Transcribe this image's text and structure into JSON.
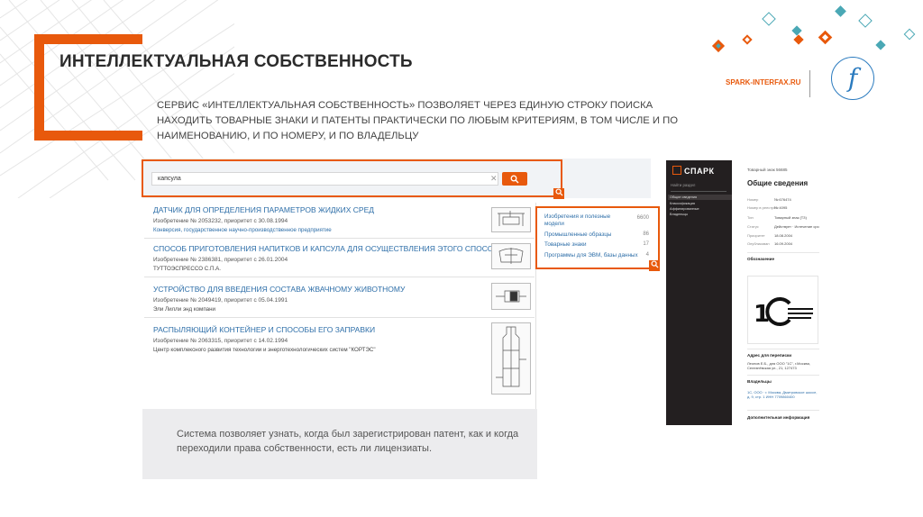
{
  "slide": {
    "title": "ИНТЕЛЛЕКТУАЛЬНАЯ СОБСТВЕННОСТЬ",
    "subtitle": "Сервис «Интеллектуальная собственность» позволяет через единую строку поиска находить товарные знаки и патенты практически по любым критериям, в том числе и по наименованию, и по номеру, и по владельцу",
    "brand_url": "SPARK-INTERFAX.RU",
    "brand_logo_glyph": "f",
    "info_text": "Система позволяет узнать, когда был зарегистрирован патент, как и когда переходили права собственности, есть ли лицензиаты."
  },
  "colors": {
    "accent": "#e8590c",
    "link": "#2d6ea8",
    "brand_blue": "#2b7bbf",
    "spark_dark": "#231f20"
  },
  "search": {
    "value": "капсула",
    "clear_icon": "close-icon",
    "button_icon": "search-icon"
  },
  "results": [
    {
      "title": "Датчик для определения параметров жидких сред",
      "meta": "Изобретение № 2053232, приоритет с 30.08.1994",
      "org": "Конверсия, государственное научно-производственное предприятие",
      "org_dark": false
    },
    {
      "title": "Способ приготовления напитков и капсула для осуществления этого способа",
      "meta": "Изобретение № 2386381, приоритет с 26.01.2004",
      "org": "ТУТТОЭСПРЕССО С.П.А.",
      "org_dark": true
    },
    {
      "title": "Устройство для введения состава жвачному животному",
      "meta": "Изобретение № 2049419, приоритет с 05.04.1991",
      "org": "Эли Лилли энд компани",
      "org_dark": true
    },
    {
      "title": "Распыляющий контейнер и способы его заправки",
      "meta": "Изобретение № 2063315, приоритет с 14.02.1994",
      "org": "Центр комплексного развития технологии и энерготехнологических систем \"КОРТЭС\"",
      "org_dark": true
    }
  ],
  "filters": [
    {
      "label": "Изобретения и полезные модели",
      "count": "6600"
    },
    {
      "label": "Промышленные образцы",
      "count": "86"
    },
    {
      "label": "Товарные знаки",
      "count": "17"
    },
    {
      "label": "Программы для ЭВМ, базы данных",
      "count": "4"
    }
  ],
  "spark": {
    "logo": "СПАРК",
    "search_placeholder": "Найти раздел",
    "nav": [
      "Общие сведения",
      "Классификация",
      "Аффилированные",
      "Владельцы"
    ],
    "doc_type": "Товарный знак 56685",
    "heading": "Общие сведения",
    "fields": [
      {
        "k": "Номер",
        "v": "№ 676474"
      },
      {
        "k": "Номер в реестре",
        "v": "№ 4095"
      },
      {
        "k": "Тип",
        "v": "Товарный знак (ТЗ)"
      },
      {
        "k": "Статус",
        "v": "Действует · Истечение срока 18.09.2028"
      },
      {
        "k": "Приоритет",
        "v": "18.08.2004"
      },
      {
        "k": "Опубликован",
        "v": "16.09.2004"
      }
    ],
    "image_label": "Обозначение",
    "logo_text": "1С",
    "address_title": "Адрес для переписки",
    "address": "Леонов Е.Б., для ООО \"1С\", г.Москва, Селезнёвская ул., 21, 127473",
    "owners_title": "Владельцы",
    "owner": "1С, ООО · г. Москва, Дмитровское шоссе, д. 9, стр. 1 ИНН 7709860400",
    "extra_title": "Дополнительная информация"
  }
}
